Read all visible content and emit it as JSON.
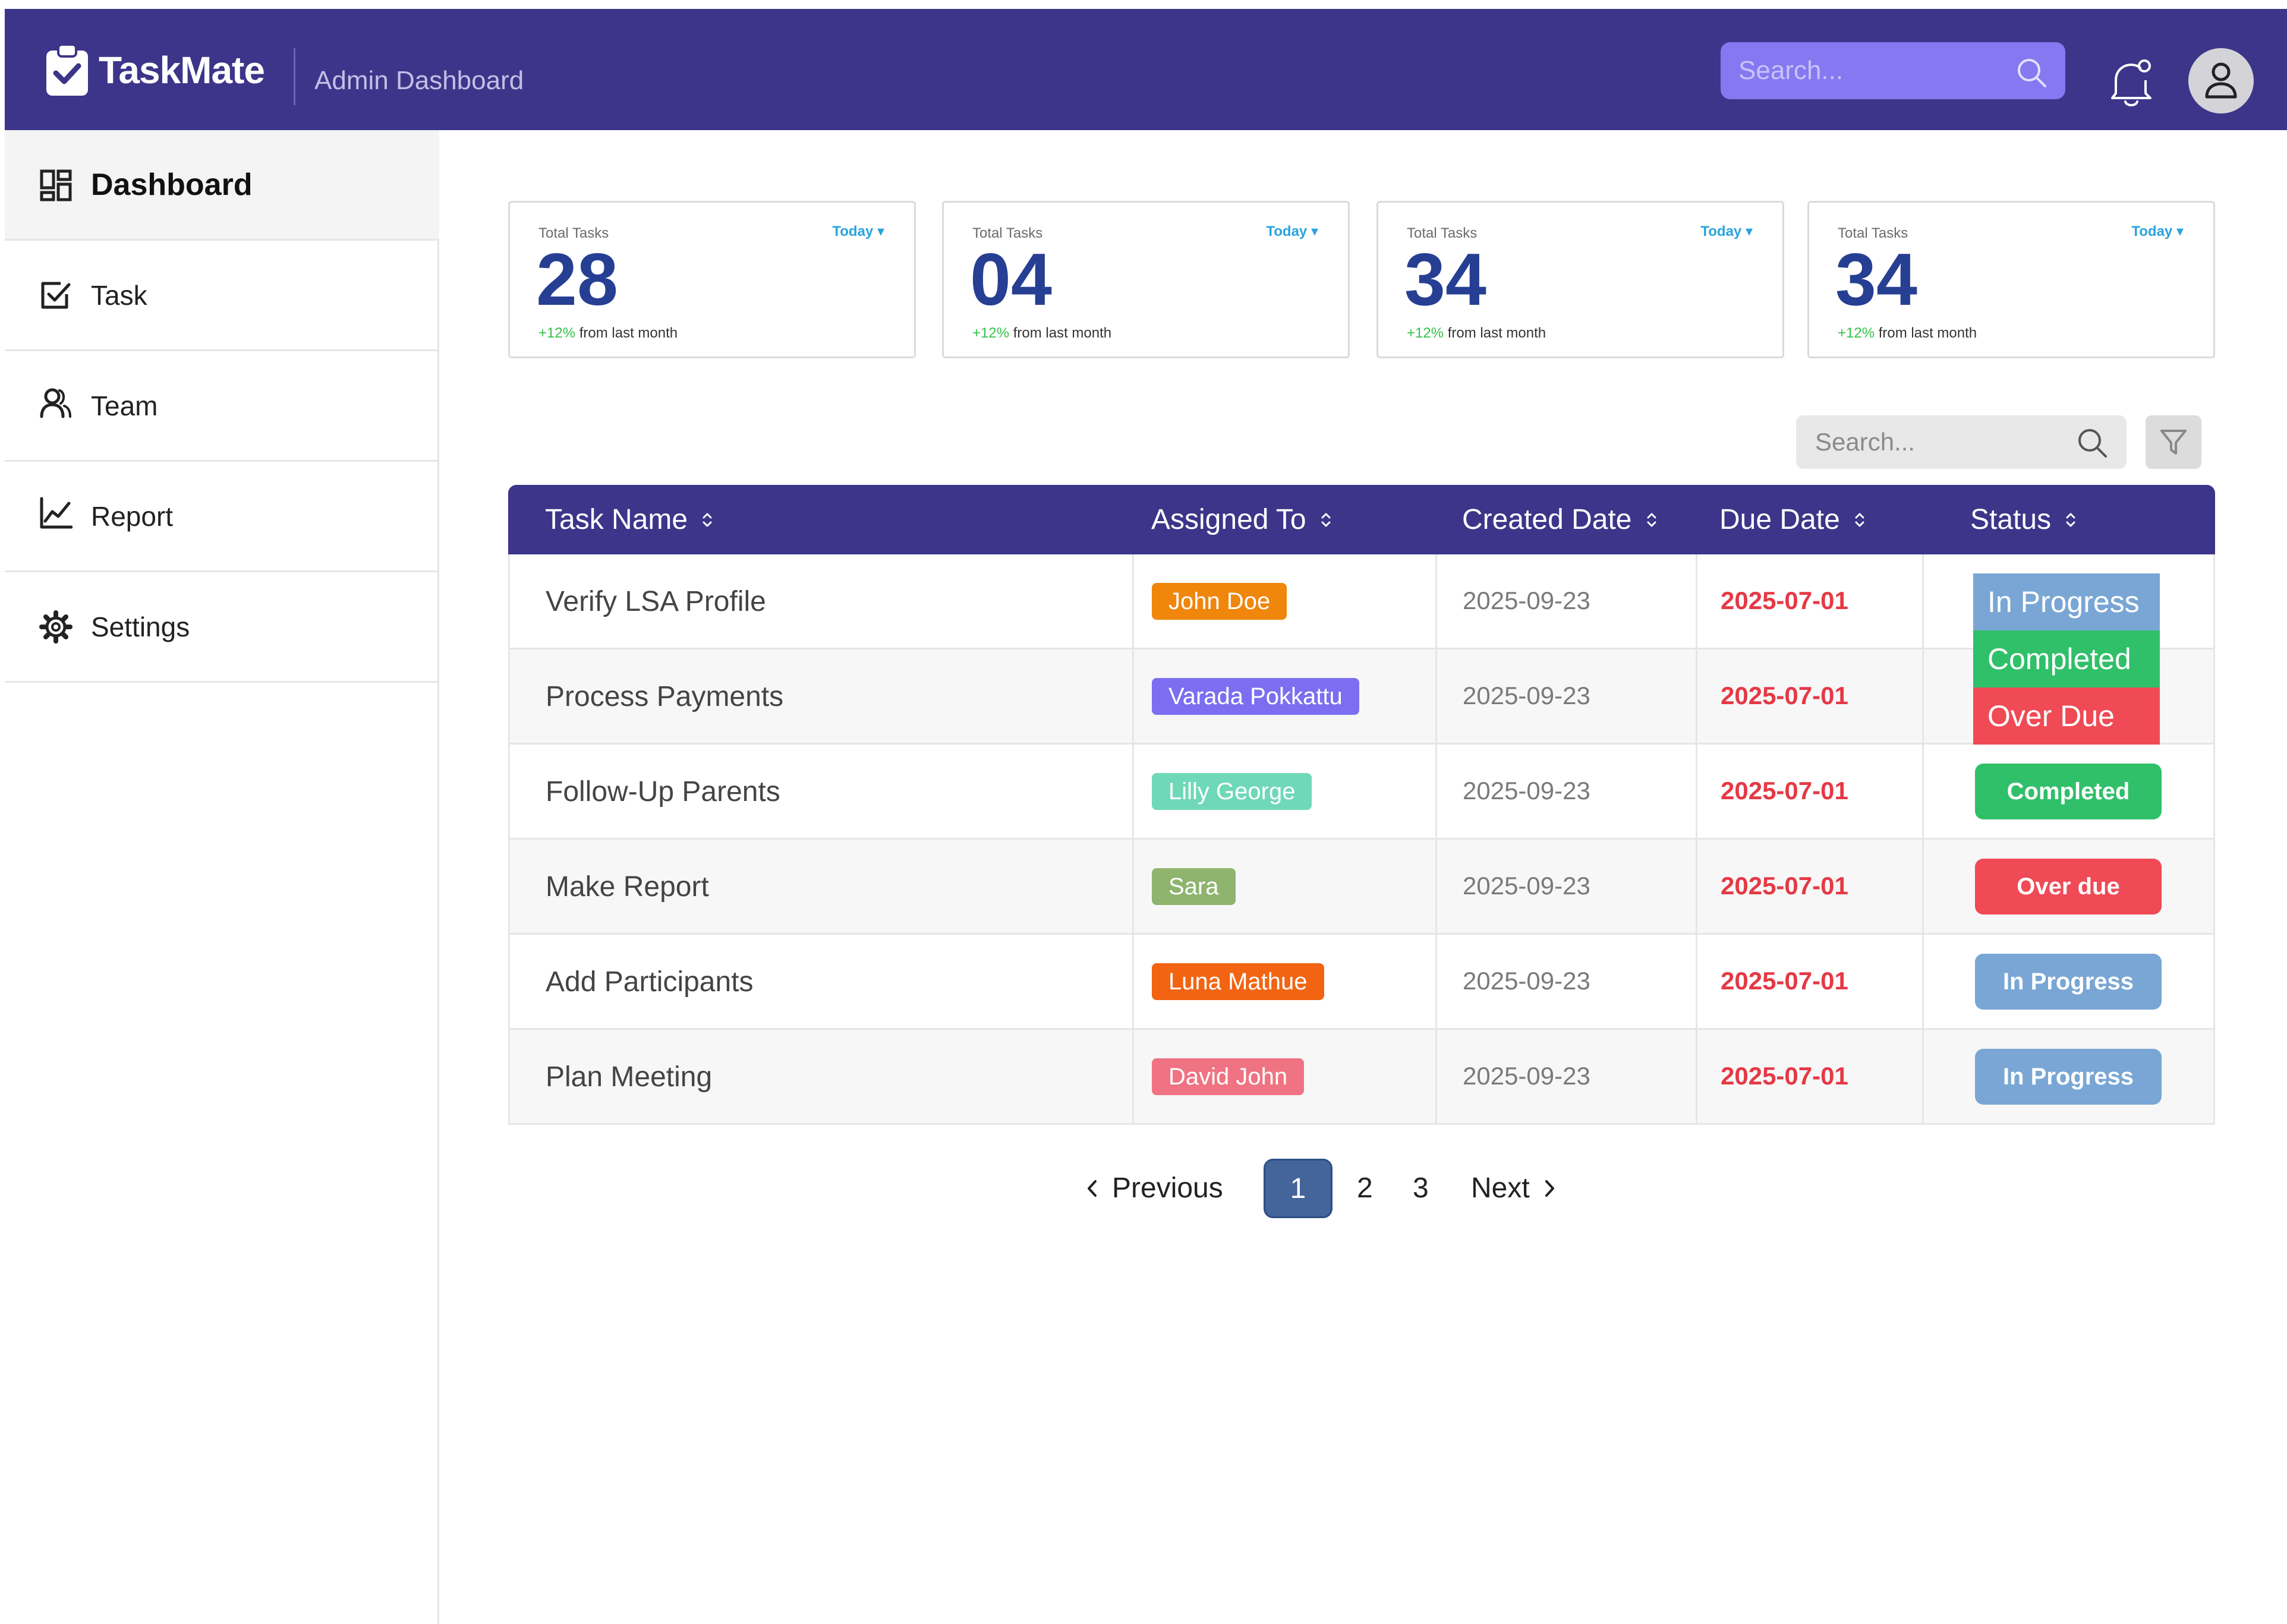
{
  "app": {
    "name": "TaskMate",
    "subtitle": "Admin Dashboard"
  },
  "header": {
    "search_placeholder": "Search..."
  },
  "sidebar": {
    "items": [
      {
        "label": "Dashboard",
        "icon": "dashboard-grid-icon",
        "active": true
      },
      {
        "label": "Task",
        "icon": "checkbox-icon"
      },
      {
        "label": "Team",
        "icon": "team-users-icon"
      },
      {
        "label": "Report",
        "icon": "line-chart-icon"
      },
      {
        "label": "Settings",
        "icon": "gear-icon"
      }
    ]
  },
  "stats": [
    {
      "label": "Total Tasks",
      "range": "Today",
      "value": "28",
      "change": "+12%",
      "change_text": "from last month"
    },
    {
      "label": "Total Tasks",
      "range": "Today",
      "value": "04",
      "change": "+12%",
      "change_text": "from last month"
    },
    {
      "label": "Total Tasks",
      "range": "Today",
      "value": "34",
      "change": "+12%",
      "change_text": "from last month"
    },
    {
      "label": "Total Tasks",
      "range": "Today",
      "value": "34",
      "change": "+12%",
      "change_text": "from last month"
    }
  ],
  "table_toolbar": {
    "search_placeholder": "Search..."
  },
  "table": {
    "columns": [
      "Task Name",
      "Assigned To",
      "Created Date",
      "Due Date",
      "Status"
    ],
    "rows": [
      {
        "task": "Verify LSA Profile",
        "assignee": "John Doe",
        "assignee_color": "#f0860c",
        "created": "2025-09-23",
        "due": "2025-07-01",
        "status": ""
      },
      {
        "task": "Process Payments",
        "assignee": "Varada Pokkattu",
        "assignee_color": "#7b6ef0",
        "created": "2025-09-23",
        "due": "2025-07-01",
        "status": ""
      },
      {
        "task": "Follow-Up Parents",
        "assignee": "Lilly George",
        "assignee_color": "#6ed8b7",
        "created": "2025-09-23",
        "due": "2025-07-01",
        "status": "Completed",
        "status_color": "#2fc069"
      },
      {
        "task": "Make Report",
        "assignee": "Sara",
        "assignee_color": "#8fb46e",
        "created": "2025-09-23",
        "due": "2025-07-01",
        "status": "Over due",
        "status_color": "#ef4a55"
      },
      {
        "task": "Add Participants",
        "assignee": "Luna Mathue",
        "assignee_color": "#f26412",
        "created": "2025-09-23",
        "due": "2025-07-01",
        "status": "In Progress",
        "status_color": "#79a6d4"
      },
      {
        "task": "Plan Meeting",
        "assignee": "David John",
        "assignee_color": "#ef7382",
        "created": "2025-09-23",
        "due": "2025-07-01",
        "status": "In Progress",
        "status_color": "#79a6d4"
      }
    ]
  },
  "status_dropdown": {
    "options": [
      {
        "label": "In Progress",
        "color": "#79a6d4"
      },
      {
        "label": "Completed",
        "color": "#2fc069"
      },
      {
        "label": "Over Due",
        "color": "#ef4a55"
      }
    ]
  },
  "pagination": {
    "previous": "Previous",
    "next": "Next",
    "pages": [
      "1",
      "2",
      "3"
    ],
    "current": "1"
  }
}
